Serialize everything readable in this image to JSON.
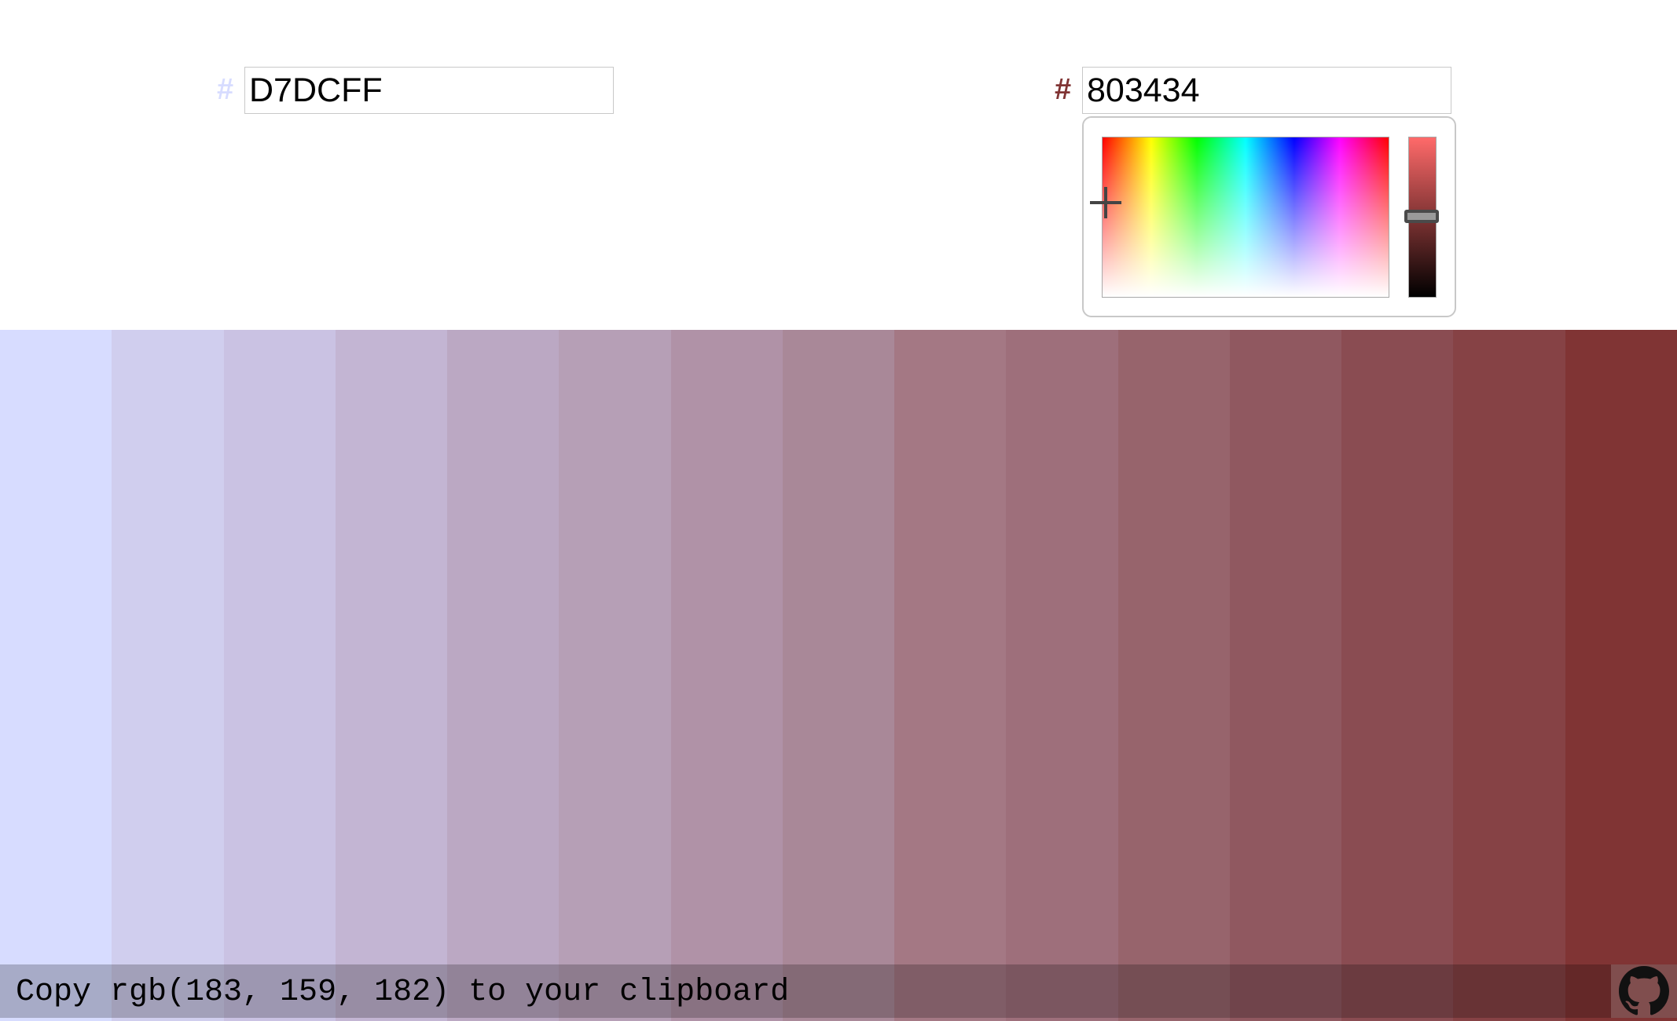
{
  "start_color": {
    "hash_symbol": "#",
    "hex_value": "D7DCFF",
    "hash_color": "#D7DCFF"
  },
  "end_color": {
    "hash_symbol": "#",
    "hex_value": "803434",
    "hash_color": "#803434"
  },
  "picker": {
    "hue": "red",
    "value_color": "#803434"
  },
  "swatches": [
    "#D7DCFF",
    "#D0CEEE",
    "#CAC2E3",
    "#C3B5D3",
    "#BBA8C3",
    "#B69FB6",
    "#B092A7",
    "#A98898",
    "#A47884",
    "#9E6F7B",
    "#97646C",
    "#905860",
    "#8A4C52",
    "#864245",
    "#803434"
  ],
  "clipboard_bar": {
    "text": "Copy rgb(183, 159, 182) to your clipboard"
  },
  "github": {
    "icon": "github-icon"
  }
}
